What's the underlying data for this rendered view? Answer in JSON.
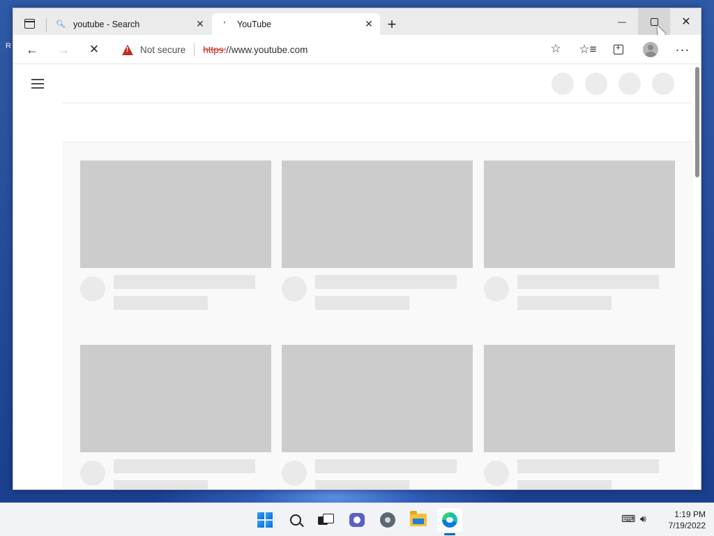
{
  "desktop": {
    "letter": "R"
  },
  "browser": {
    "tabs": [
      {
        "title": "youtube - Search",
        "icon": "search-icon",
        "active": false
      },
      {
        "title": "YouTube",
        "icon": "loading-icon",
        "active": true
      }
    ],
    "window_controls": {
      "minimize": "—",
      "close": "✕"
    },
    "address_bar": {
      "security_label": "Not secure",
      "url_protocol": "https:",
      "url_rest": "//www.youtube.com"
    },
    "toolbar_icons": [
      "back-icon",
      "forward-icon",
      "stop-icon",
      "add-favorite-icon",
      "favorites-icon",
      "collections-icon",
      "profile-icon",
      "more-icon"
    ]
  },
  "page": {
    "state": "loading-skeleton",
    "header_placeholders": 4,
    "card_rows": 2,
    "cards_per_row": 3
  },
  "taskbar": {
    "apps": [
      "start-icon",
      "search-icon",
      "task-view-icon",
      "chat-icon",
      "settings-icon",
      "file-explorer-icon",
      "edge-icon"
    ],
    "active_app": "edge-icon",
    "clock": {
      "time": "1:19 PM",
      "date": "7/19/2022"
    }
  }
}
